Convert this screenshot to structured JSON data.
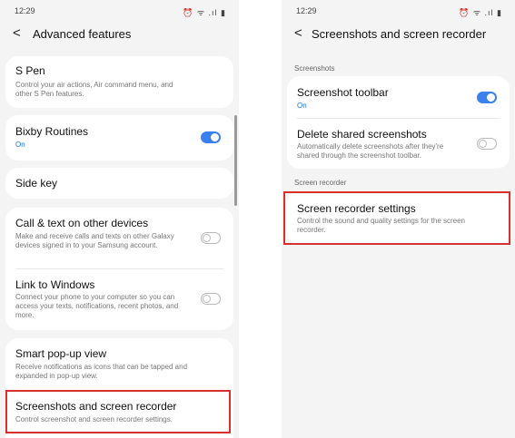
{
  "left": {
    "status": {
      "time": "12:29",
      "right_icons": "⏰ ᯤ .ıl ▮"
    },
    "header": {
      "back": "<",
      "title": "Advanced features"
    },
    "items": {
      "spen": {
        "title": "S Pen",
        "subtitle": "Control your air actions, Air command menu, and other S Pen features."
      },
      "bixby": {
        "title": "Bixby Routines",
        "status": "On",
        "toggle": "on"
      },
      "sidekey": {
        "title": "Side key"
      },
      "calltext": {
        "title": "Call & text on other devices",
        "subtitle": "Make and receive calls and texts on other Galaxy devices signed in to your Samsung account.",
        "toggle": "off"
      },
      "linkwin": {
        "title": "Link to Windows",
        "subtitle": "Connect your phone to your computer so you can access your texts, notifications, recent photos, and more.",
        "toggle": "off"
      },
      "smartpopup": {
        "title": "Smart pop-up view",
        "subtitle": "Receive notifications as icons that can be tapped and expanded in pop-up view."
      },
      "screenshots": {
        "title": "Screenshots and screen recorder",
        "subtitle": "Control screenshot and screen recorder settings.",
        "highlighted": true
      }
    }
  },
  "right": {
    "status": {
      "time": "12:29",
      "right_icons": "⏰ ᯤ .ıl ▮"
    },
    "header": {
      "back": "<",
      "title": "Screenshots and screen recorder"
    },
    "sections": {
      "screenshots": "Screenshots",
      "recorder": "Screen recorder"
    },
    "items": {
      "toolbar": {
        "title": "Screenshot toolbar",
        "status": "On",
        "toggle": "on"
      },
      "deleteshared": {
        "title": "Delete shared screenshots",
        "subtitle": "Automatically delete screenshots after they're shared through the screenshot toolbar.",
        "toggle": "off"
      },
      "recsettings": {
        "title": "Screen recorder settings",
        "subtitle": "Control the sound and quality settings for the screen recorder.",
        "highlighted": true
      }
    }
  },
  "colors": {
    "accent": "#3a80f0",
    "highlight": "#d9302e",
    "background": "#f4f4f4"
  }
}
